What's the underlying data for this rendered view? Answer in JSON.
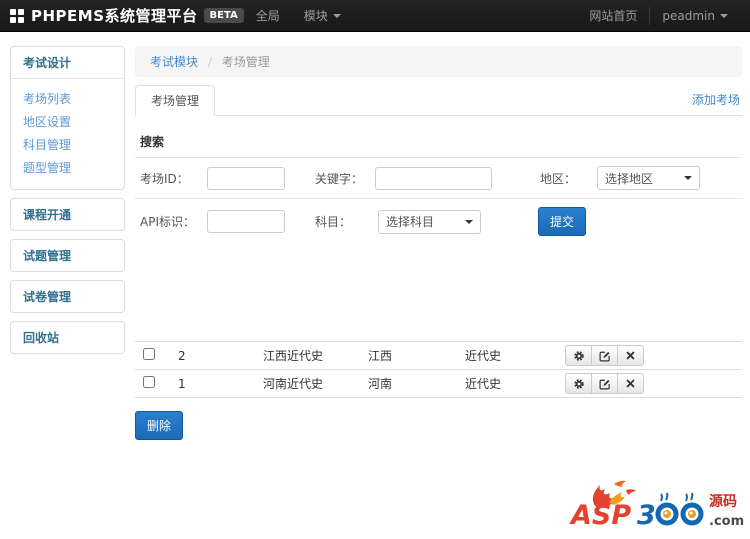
{
  "navbar": {
    "brand": "PHPEMS系统管理平台",
    "beta_label": "BETA",
    "menu": [
      {
        "label": "全局"
      },
      {
        "label": "模块"
      }
    ],
    "right": [
      {
        "label": "网站首页"
      },
      {
        "label": "peadmin"
      }
    ]
  },
  "sidebar": {
    "sections": [
      {
        "header": "考试设计",
        "links": [
          "考场列表",
          "地区设置",
          "科目管理",
          "题型管理"
        ]
      },
      {
        "header": "课程开通",
        "links": []
      },
      {
        "header": "试题管理",
        "links": []
      },
      {
        "header": "试卷管理",
        "links": []
      },
      {
        "header": "回收站",
        "links": []
      }
    ]
  },
  "breadcrumb": {
    "module": "考试模块",
    "separator": "/",
    "page": "考场管理"
  },
  "tabs": {
    "active_label": "考场管理",
    "add_link": "添加考场"
  },
  "search": {
    "title": "搜索",
    "room_id_label": "考场ID：",
    "keyword_label": "关键字：",
    "region_label": "地区：",
    "region_value": "选择地区",
    "api_label": "API标识：",
    "subject_label": "科目：",
    "subject_value": "选择科目",
    "submit_label": "提交"
  },
  "table": {
    "rows": [
      {
        "id": "2",
        "name": "江西近代史",
        "region": "江西",
        "subject": "近代史"
      },
      {
        "id": "1",
        "name": "河南近代史",
        "region": "河南",
        "subject": "近代史"
      }
    ],
    "delete_label": "删除"
  },
  "watermark": {
    "asp": "ASP",
    "three": "3",
    "yuanma": "源码",
    "com": ".com"
  },
  "icons": {
    "grid": "th-large",
    "caret": "caret-down",
    "gear": "settings",
    "edit": "edit",
    "remove": "x"
  },
  "colors": {
    "navbar_bg": "#1c1c1c",
    "navbar_text": "#9d9d9d",
    "accent_link": "#428bca",
    "primary_button": "#1b6ab8",
    "sidebar_header": "#31708f",
    "sidebar_link": "#5b9bd3",
    "border": "#dddddd",
    "breadcrumb_bg": "#f5f5f5",
    "logo_red": "#e2432f",
    "logo_blue": "#1467b3",
    "logo_orange": "#f59b1e"
  }
}
